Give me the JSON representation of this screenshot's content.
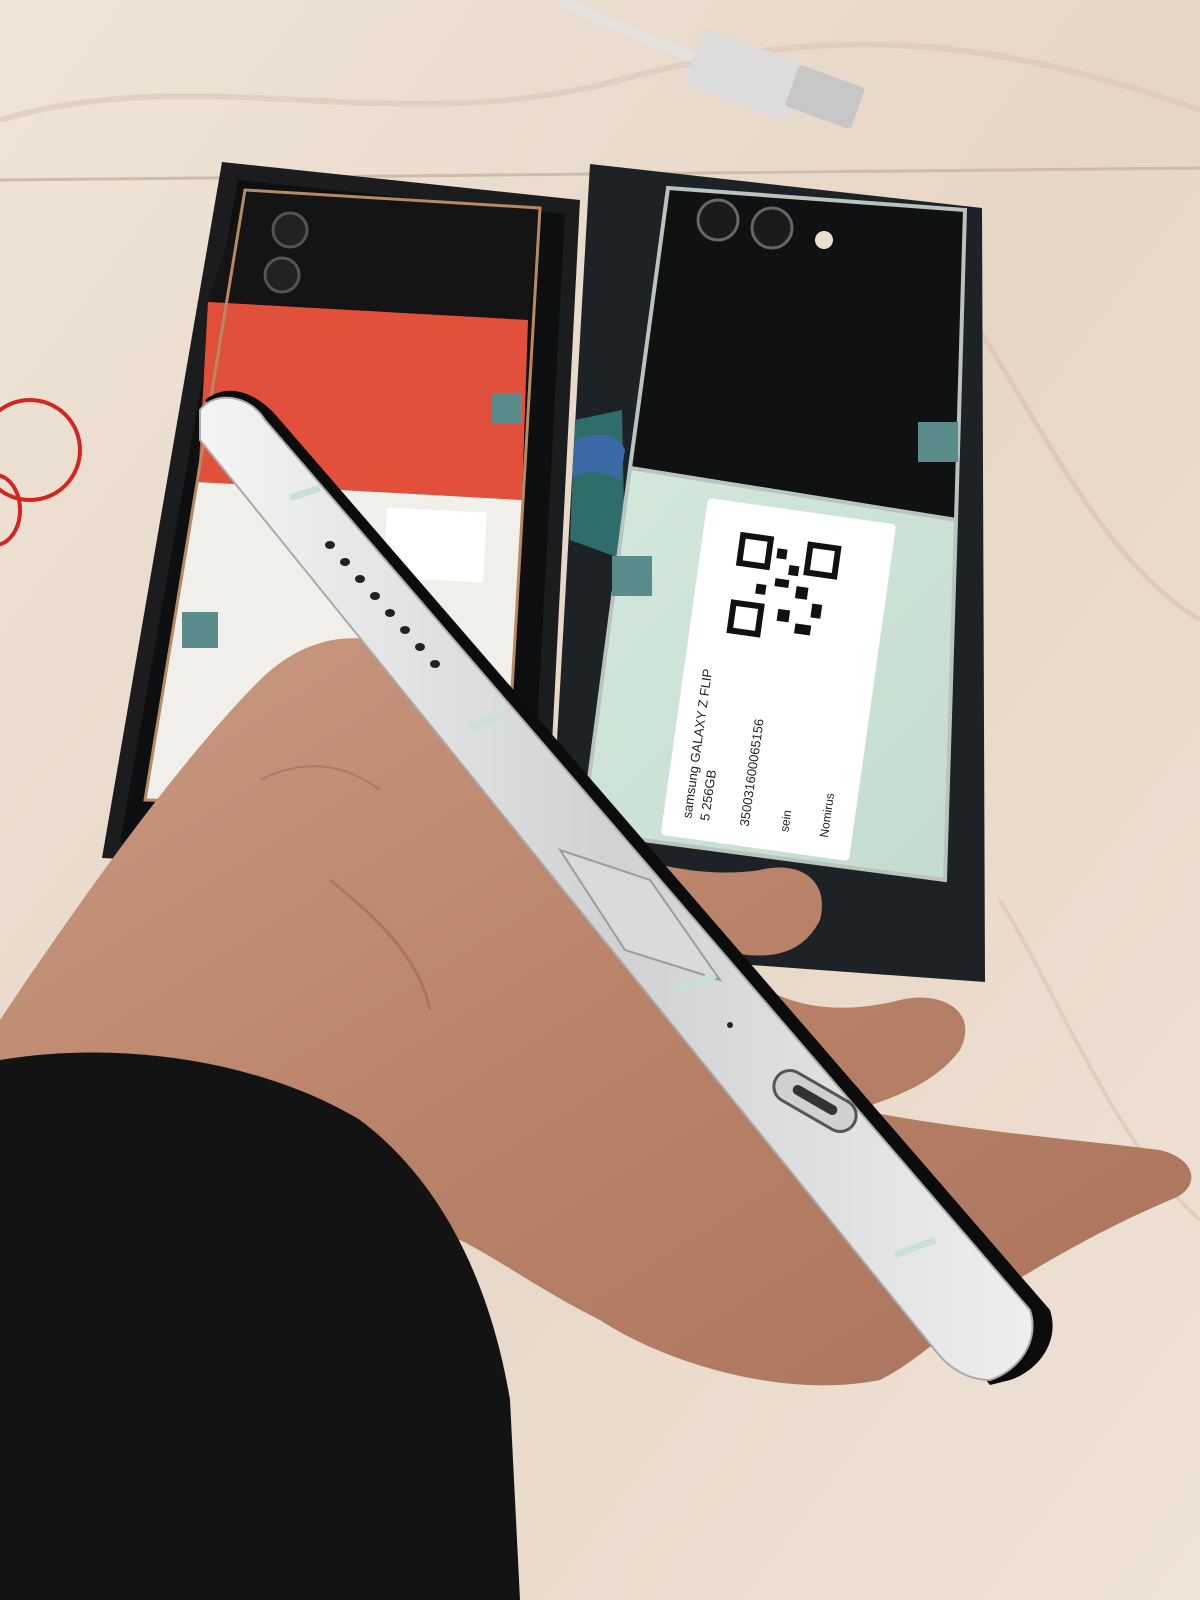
{
  "photo": {
    "label": {
      "brand_model": "samsung GALAXY Z FLIP",
      "model_storage": "5 256GB",
      "imei": "350031600065156",
      "color_left": "sein",
      "color_right": "Nomirus"
    }
  }
}
